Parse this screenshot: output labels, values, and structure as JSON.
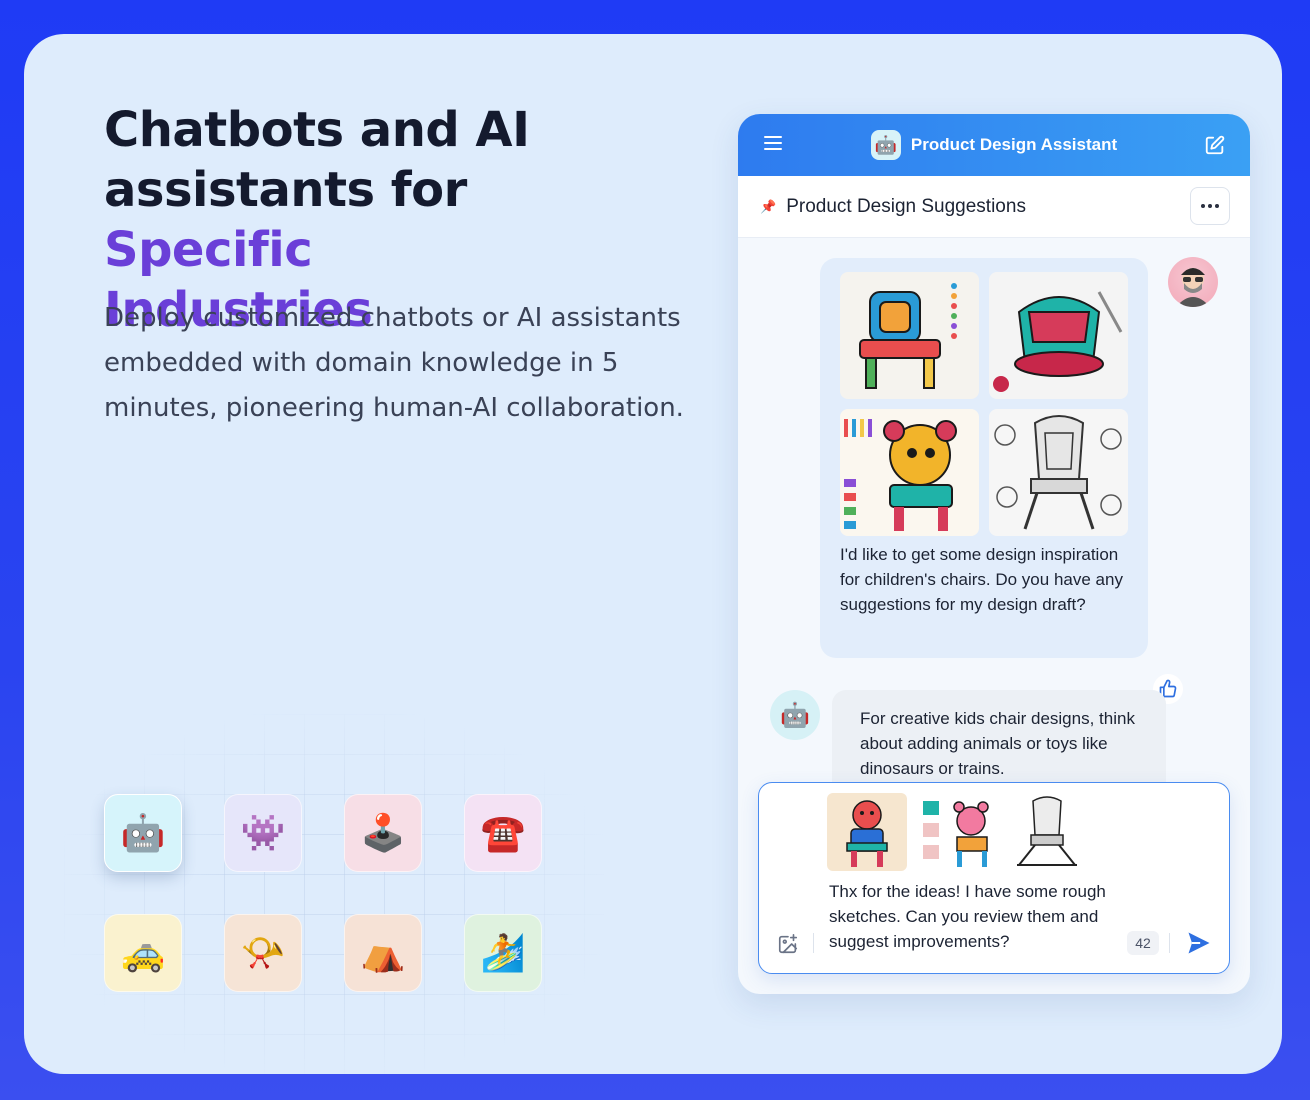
{
  "hero": {
    "title_line1": "Chatbots and AI",
    "title_line2_pre": "assistants for ",
    "title_accent_1": "Specific",
    "title_accent_2": "Industries",
    "subtitle": "Deploy customized chatbots or AI assistants embedded with domain knowledge in 5 minutes, pioneering human-AI collaboration.",
    "accent_color": "#6a3fd8"
  },
  "tiles": [
    {
      "icon": "robot-icon",
      "glyph": "🤖",
      "bg": "#d6f4fb"
    },
    {
      "icon": "alien-monster-icon",
      "glyph": "👾",
      "bg": "#e6e6fa"
    },
    {
      "icon": "joystick-icon",
      "glyph": "🕹️",
      "bg": "#f7dee6"
    },
    {
      "icon": "telephone-icon",
      "glyph": "☎️",
      "bg": "#f4e2f4"
    },
    {
      "icon": "taxi-icon",
      "glyph": "🚕",
      "bg": "#faf2cf"
    },
    {
      "icon": "megaphone-icon",
      "glyph": "📯",
      "bg": "#f6e4d6"
    },
    {
      "icon": "tent-icon",
      "glyph": "⛺",
      "bg": "#f6e2d6"
    },
    {
      "icon": "surfer-icon",
      "glyph": "🏄",
      "bg": "#dff2df"
    }
  ],
  "chat": {
    "app_title": "Product Design Assistant",
    "conversation_title": "Product Design Suggestions",
    "user_message": "I'd like to get some design inspiration for children's chairs. Do you have any suggestions for my design draft?",
    "bot_message": "For creative kids chair designs, think about adding animals or toys like dinosaurs or trains.",
    "composer_text": "Thx for the ideas! I have some rough sketches. Can you review them and suggest improvements?",
    "char_count": "42",
    "header_color": "#2e7bef"
  }
}
